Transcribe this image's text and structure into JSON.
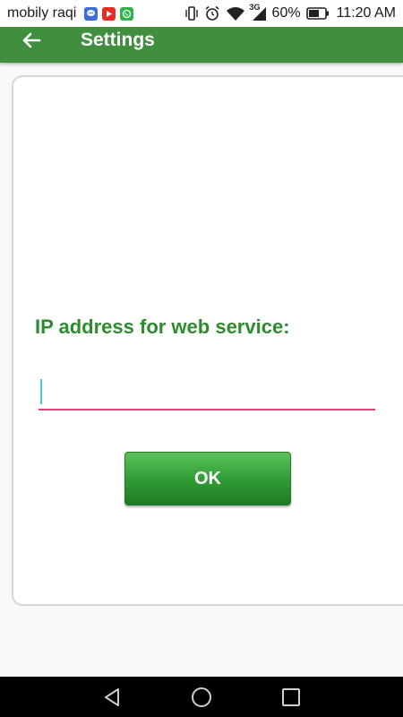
{
  "status_bar": {
    "carrier": "mobily raqi",
    "notification_icons": [
      "messages-icon",
      "youtube-icon",
      "whatsapp-icon"
    ],
    "battery_percent": "60%",
    "time": "11:20 AM",
    "network_label": "3G"
  },
  "app_bar": {
    "title": "Settings",
    "color": "#3f8f3f"
  },
  "form": {
    "ip_label": "IP address for web service:",
    "ip_value": "",
    "ok_label": "OK",
    "label_color": "#2e8b2e",
    "underline_color": "#e0457a"
  },
  "nav_bar": {
    "buttons": [
      "back-triangle-icon",
      "home-circle-icon",
      "recents-square-icon"
    ]
  }
}
